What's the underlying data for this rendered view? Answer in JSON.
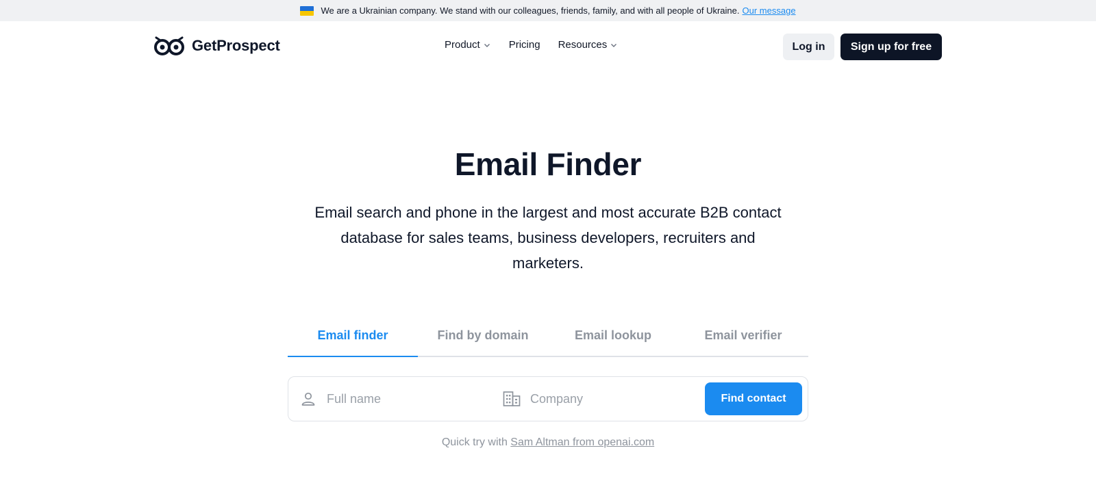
{
  "banner": {
    "message": "We are a Ukrainian company. We stand with our colleagues, friends, family, and with all people of Ukraine.",
    "link": "Our message",
    "flag_icon": "ukraine-flag-icon"
  },
  "header": {
    "logo_text": "GetProspect",
    "logo_icon": "owl-logo-icon",
    "nav": [
      {
        "label": "Product",
        "has_dropdown": true
      },
      {
        "label": "Pricing",
        "has_dropdown": false
      },
      {
        "label": "Resources",
        "has_dropdown": true
      }
    ],
    "login_label": "Log in",
    "signup_label": "Sign up for free"
  },
  "hero": {
    "title": "Email Finder",
    "subtitle": "Email search and phone in the largest and most accurate B2B contact database for sales teams, business developers, recruiters and marketers."
  },
  "tabs": [
    {
      "label": "Email finder",
      "active": true
    },
    {
      "label": "Find by domain",
      "active": false
    },
    {
      "label": "Email lookup",
      "active": false
    },
    {
      "label": "Email verifier",
      "active": false
    }
  ],
  "search": {
    "name_placeholder": "Full name",
    "name_value": "",
    "company_placeholder": "Company",
    "company_value": "",
    "button_label": "Find contact"
  },
  "quick_try": {
    "prefix": "Quick try with",
    "link": "Sam Altman from openai.com"
  },
  "colors": {
    "accent": "#1b8bf0",
    "dark": "#0d1526",
    "banner_bg": "#f0f1f3",
    "muted": "#8e949d"
  }
}
